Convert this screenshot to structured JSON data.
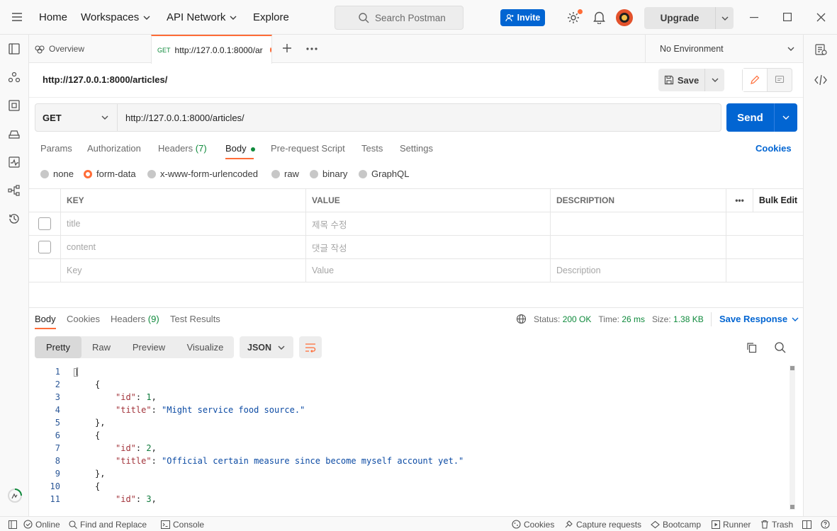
{
  "topbar": {
    "nav": [
      "Home",
      "Workspaces",
      "API Network",
      "Explore"
    ],
    "search_placeholder": "Search Postman",
    "invite_label": "Invite",
    "upgrade_label": "Upgrade"
  },
  "tabs": {
    "overview_label": "Overview",
    "active_method": "GET",
    "active_label": "http://127.0.0.1:8000/ar",
    "environment": "No Environment"
  },
  "request": {
    "title": "http://127.0.0.1:8000/articles/",
    "save_label": "Save",
    "method": "GET",
    "url": "http://127.0.0.1:8000/articles/",
    "send_label": "Send",
    "subtabs": [
      "Params",
      "Authorization",
      "Headers",
      "(7)",
      "Body",
      "Pre-request Script",
      "Tests",
      "Settings"
    ],
    "cookies_label": "Cookies",
    "body_types": [
      "none",
      "form-data",
      "x-www-form-urlencoded",
      "raw",
      "binary",
      "GraphQL"
    ],
    "selected_body_type": "form-data"
  },
  "form_table": {
    "headers": [
      "KEY",
      "VALUE",
      "DESCRIPTION"
    ],
    "more_label": "•••",
    "bulk_edit_label": "Bulk Edit",
    "rows": [
      {
        "key": "title",
        "value": "제목 수정",
        "description": ""
      },
      {
        "key": "content",
        "value": "댓글 작성",
        "description": ""
      }
    ],
    "placeholder_row": {
      "key": "Key",
      "value": "Value",
      "description": "Description"
    }
  },
  "response": {
    "tabs": [
      "Body",
      "Cookies",
      "Headers",
      "(9)",
      "Test Results"
    ],
    "status_label": "Status:",
    "status_value": "200 OK",
    "time_label": "Time:",
    "time_value": "26 ms",
    "size_label": "Size:",
    "size_value": "1.38 KB",
    "save_response_label": "Save Response",
    "view_modes": [
      "Pretty",
      "Raw",
      "Preview",
      "Visualize"
    ],
    "format": "JSON",
    "code_lines": [
      {
        "n": "1",
        "indent": 0,
        "parts": [
          {
            "t": "[",
            "c": "p"
          }
        ]
      },
      {
        "n": "2",
        "indent": 1,
        "parts": [
          {
            "t": "{",
            "c": "p"
          }
        ]
      },
      {
        "n": "3",
        "indent": 2,
        "parts": [
          {
            "t": "\"id\"",
            "c": "key"
          },
          {
            "t": ": ",
            "c": "p"
          },
          {
            "t": "1",
            "c": "num"
          },
          {
            "t": ",",
            "c": "p"
          }
        ]
      },
      {
        "n": "4",
        "indent": 2,
        "parts": [
          {
            "t": "\"title\"",
            "c": "key"
          },
          {
            "t": ": ",
            "c": "p"
          },
          {
            "t": "\"Might service food source.\"",
            "c": "str"
          }
        ]
      },
      {
        "n": "5",
        "indent": 1,
        "parts": [
          {
            "t": "},",
            "c": "p"
          }
        ]
      },
      {
        "n": "6",
        "indent": 1,
        "parts": [
          {
            "t": "{",
            "c": "p"
          }
        ]
      },
      {
        "n": "7",
        "indent": 2,
        "parts": [
          {
            "t": "\"id\"",
            "c": "key"
          },
          {
            "t": ": ",
            "c": "p"
          },
          {
            "t": "2",
            "c": "num"
          },
          {
            "t": ",",
            "c": "p"
          }
        ]
      },
      {
        "n": "8",
        "indent": 2,
        "parts": [
          {
            "t": "\"title\"",
            "c": "key"
          },
          {
            "t": ": ",
            "c": "p"
          },
          {
            "t": "\"Official certain measure since become myself account yet.\"",
            "c": "str"
          }
        ]
      },
      {
        "n": "9",
        "indent": 1,
        "parts": [
          {
            "t": "},",
            "c": "p"
          }
        ]
      },
      {
        "n": "10",
        "indent": 1,
        "parts": [
          {
            "t": "{",
            "c": "p"
          }
        ]
      },
      {
        "n": "11",
        "indent": 2,
        "parts": [
          {
            "t": "\"id\"",
            "c": "key"
          },
          {
            "t": ": ",
            "c": "p"
          },
          {
            "t": "3",
            "c": "num"
          },
          {
            "t": ",",
            "c": "p"
          }
        ]
      }
    ]
  },
  "footer": {
    "online": "Online",
    "find_replace": "Find and Replace",
    "console": "Console",
    "cookies": "Cookies",
    "capture": "Capture requests",
    "bootcamp": "Bootcamp",
    "runner": "Runner",
    "trash": "Trash"
  },
  "colors": {
    "accent": "#ff6c37",
    "primary": "#0265d2",
    "status_ok": "#0f8a3c"
  }
}
